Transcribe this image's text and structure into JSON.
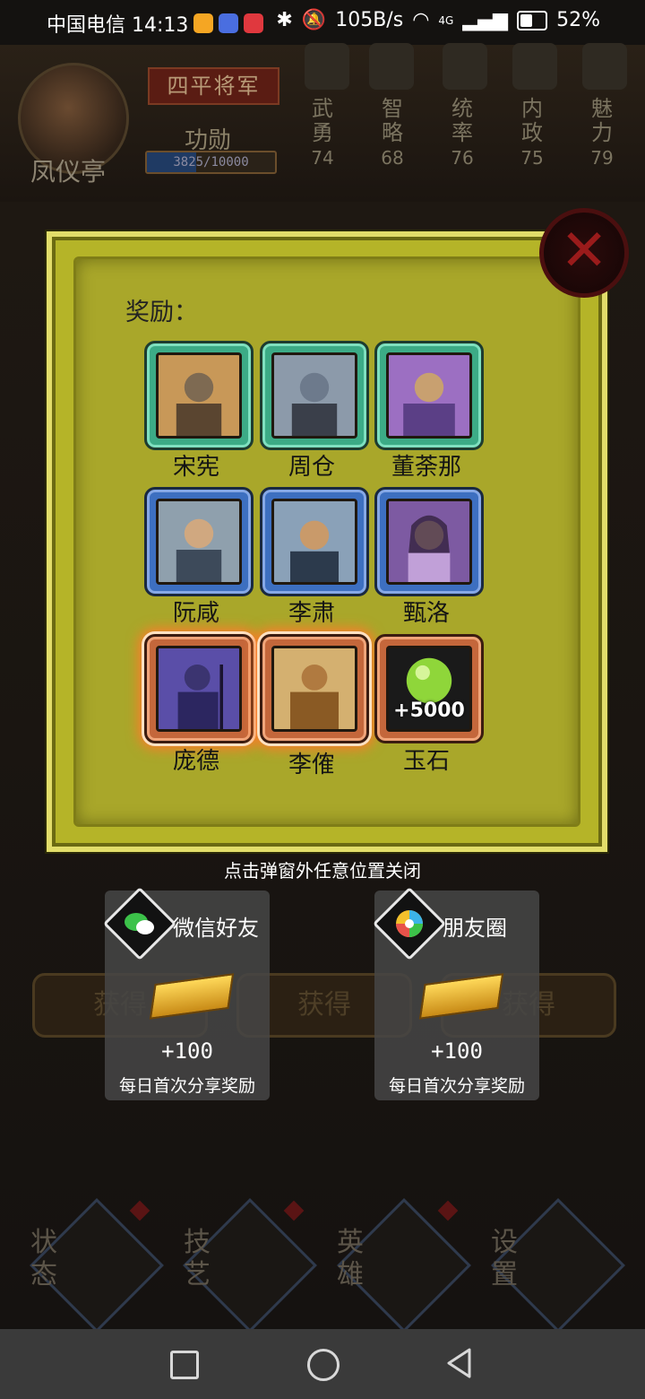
{
  "status_bar": {
    "carrier_time": "中国电信 14:13",
    "speed": "105B/s",
    "network": "4G",
    "battery": "52%"
  },
  "background": {
    "player_name": "凤仪亭",
    "title": "四平将军",
    "merit_label": "功勋",
    "merit_text": "3825/10000",
    "merit_progress": 0.3825,
    "stats": [
      {
        "name": "武勇",
        "value": "74"
      },
      {
        "name": "智略",
        "value": "68"
      },
      {
        "name": "统率",
        "value": "76"
      },
      {
        "name": "内政",
        "value": "75"
      },
      {
        "name": "魅力",
        "value": "79"
      }
    ],
    "get_buttons": [
      "获得",
      "获得",
      "获得"
    ],
    "bottom_nav": [
      {
        "label": "状态",
        "icon": "dragon-icon"
      },
      {
        "label": "技艺",
        "icon": "flame-icon"
      },
      {
        "label": "英雄",
        "icon": "helmet-icon"
      },
      {
        "label": "设置",
        "icon": "gear-icon"
      }
    ]
  },
  "modal": {
    "reward_label": "奖励：",
    "rewards": [
      {
        "name": "宋宪",
        "rarity": "green",
        "color_a": "#7e6a52",
        "color_b": "#c89858"
      },
      {
        "name": "周仓",
        "rarity": "green",
        "color_a": "#6d7a8c",
        "color_b": "#3a3f4a"
      },
      {
        "name": "董荼那",
        "rarity": "green",
        "color_a": "#5b3f86",
        "color_b": "#9c6fc2"
      },
      {
        "name": "阮咸",
        "rarity": "blue",
        "color_a": "#8fa0ad",
        "color_b": "#3d4a5a"
      },
      {
        "name": "李肃",
        "rarity": "blue",
        "color_a": "#8aa1b8",
        "color_b": "#2c3a4c"
      },
      {
        "name": "甄洛",
        "rarity": "blue",
        "color_a": "#7d5aa2",
        "color_b": "#c1a0d8"
      },
      {
        "name": "庞德",
        "rarity": "orange",
        "color_a": "#5a4ea8",
        "color_b": "#2c2660"
      },
      {
        "name": "李傕",
        "rarity": "orange",
        "color_a": "#d4b070",
        "color_b": "#8a5a24"
      },
      {
        "name": "玉石",
        "rarity": "orange",
        "amount": "+5000",
        "color_a": "#8fd63a",
        "color_b": "#1a1a1a"
      }
    ],
    "close_hint": "点击弹窗外任意位置关闭"
  },
  "share": [
    {
      "title": "微信好友",
      "amount": "+100",
      "desc": "每日首次分享奖励",
      "icon": "wechat-icon"
    },
    {
      "title": "朋友圈",
      "amount": "+100",
      "desc": "每日首次分享奖励",
      "icon": "moments-icon"
    }
  ]
}
